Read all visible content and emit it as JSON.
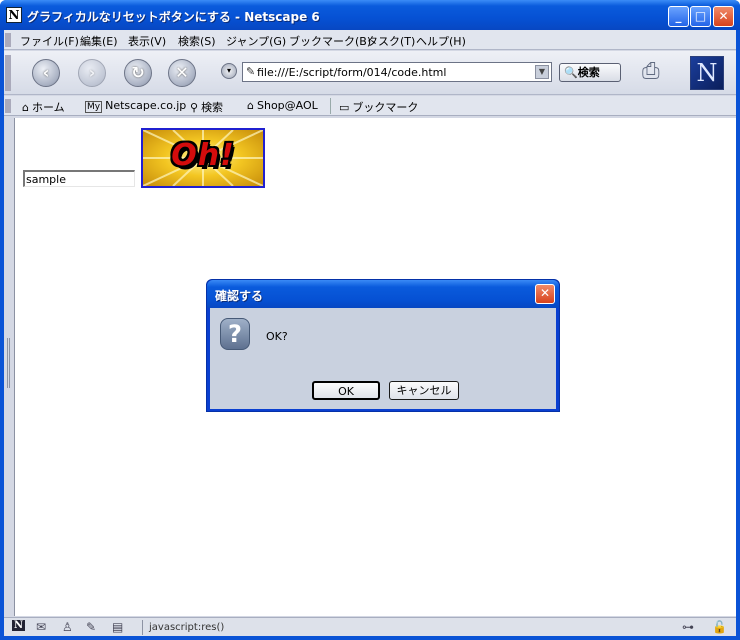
{
  "window": {
    "title": "グラフィカルなリセットボタンにする - Netscape 6",
    "app_icon_letter": "N",
    "minimize": "_",
    "maximize": "□",
    "close": "✕"
  },
  "menu": {
    "items": [
      "ファイル(F)",
      "編集(E)",
      "表示(V)",
      "検索(S)",
      "ジャンプ(G)",
      "ブックマーク(B)",
      "タスク(T)",
      "ヘルプ(H)"
    ]
  },
  "navbar": {
    "url": "file:///E:/script/form/014/code.html",
    "search_label": "検索",
    "logo_letter": "N"
  },
  "personal_toolbar": {
    "items": [
      "ホーム",
      "Netscape.co.jp",
      "検索",
      "Shop@AOL",
      "ブックマーク"
    ],
    "my_badge": "My"
  },
  "content": {
    "text_field_value": "sample",
    "image_button_text": "Oh!"
  },
  "dialog": {
    "title": "確認する",
    "message": "OK?",
    "ok_label": "OK",
    "cancel_label": "キャンセル",
    "question_glyph": "?"
  },
  "statusbar": {
    "text": "javascript:res()"
  },
  "colors": {
    "title_blue": "#0a5bdc",
    "close_red": "#d8421c",
    "chrome_gray": "#d4d8e4"
  }
}
